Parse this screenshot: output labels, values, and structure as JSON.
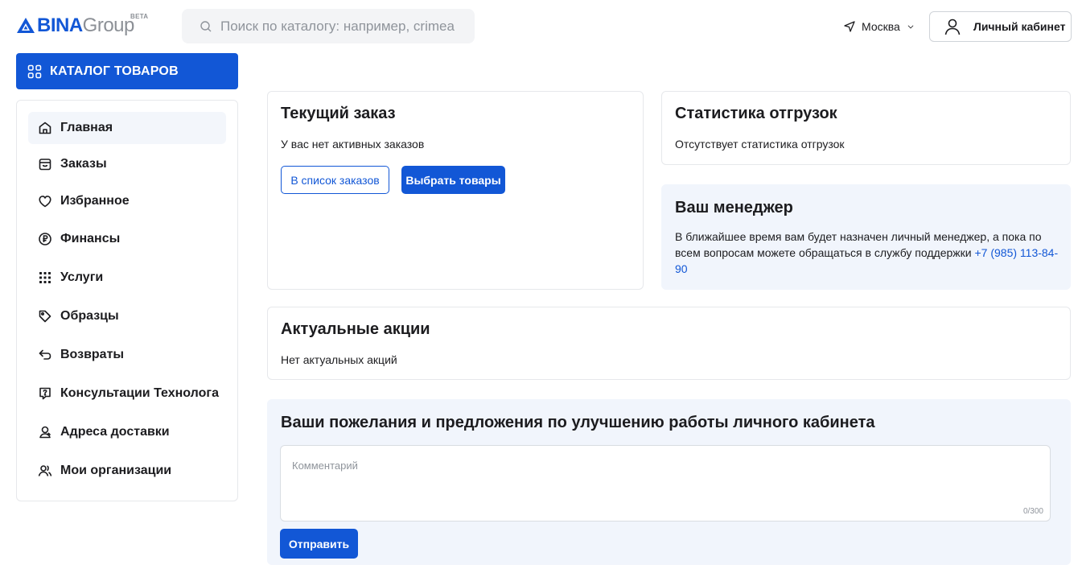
{
  "header": {
    "logo_bina": "BINA",
    "logo_group": "Group",
    "logo_beta": "BETA",
    "search_placeholder": "Поиск по каталогу: например, crimea",
    "search_value": "",
    "city": "Москва",
    "account_label": "Личный кабинет"
  },
  "catalog_button": "КАТАЛОГ ТОВАРОВ",
  "sidebar": {
    "active_index": 0,
    "items": [
      {
        "label": "Главная",
        "icon": "home-icon"
      },
      {
        "label": "Заказы",
        "icon": "bag-icon"
      },
      {
        "label": "Избранное",
        "icon": "heart-icon"
      },
      {
        "label": "Финансы",
        "icon": "ruble-icon"
      },
      {
        "label": "Услуги",
        "icon": "grid-dots-icon"
      },
      {
        "label": "Образцы",
        "icon": "tag-icon"
      },
      {
        "label": "Возвраты",
        "icon": "return-arrow-icon"
      },
      {
        "label": "Консультации Технолога",
        "icon": "question-chat-icon"
      },
      {
        "label": "Адреса доставки",
        "icon": "location-person-icon"
      },
      {
        "label": "Мои организации",
        "icon": "users-icon"
      }
    ]
  },
  "current_order": {
    "title": "Текущий заказ",
    "text": "У вас нет активных заказов",
    "btn_orders": "В список заказов",
    "btn_choose": "Выбрать товары"
  },
  "shipments": {
    "title": "Статистика отгрузок",
    "text": "Отсутствует статистика отгрузок"
  },
  "manager": {
    "title": "Ваш менеджер",
    "text": "В ближайшее время вам будет назначен личный менеджер, а пока по всем вопросам можете обращаться в службу поддержки ",
    "phone": "+7 (985) 113-84-90"
  },
  "promotions": {
    "title": "Актуальные акции",
    "text": "Нет актуальных акций"
  },
  "feedback": {
    "title": "Ваши пожелания и предложения по улучшению работы личного кабинета",
    "comment_placeholder": "Комментарий",
    "comment_value": "",
    "counter": "0/300",
    "submit": "Отправить"
  },
  "colors": {
    "accent": "#1257d6",
    "tint": "#f1f5fc",
    "border": "#e6e8eb"
  }
}
